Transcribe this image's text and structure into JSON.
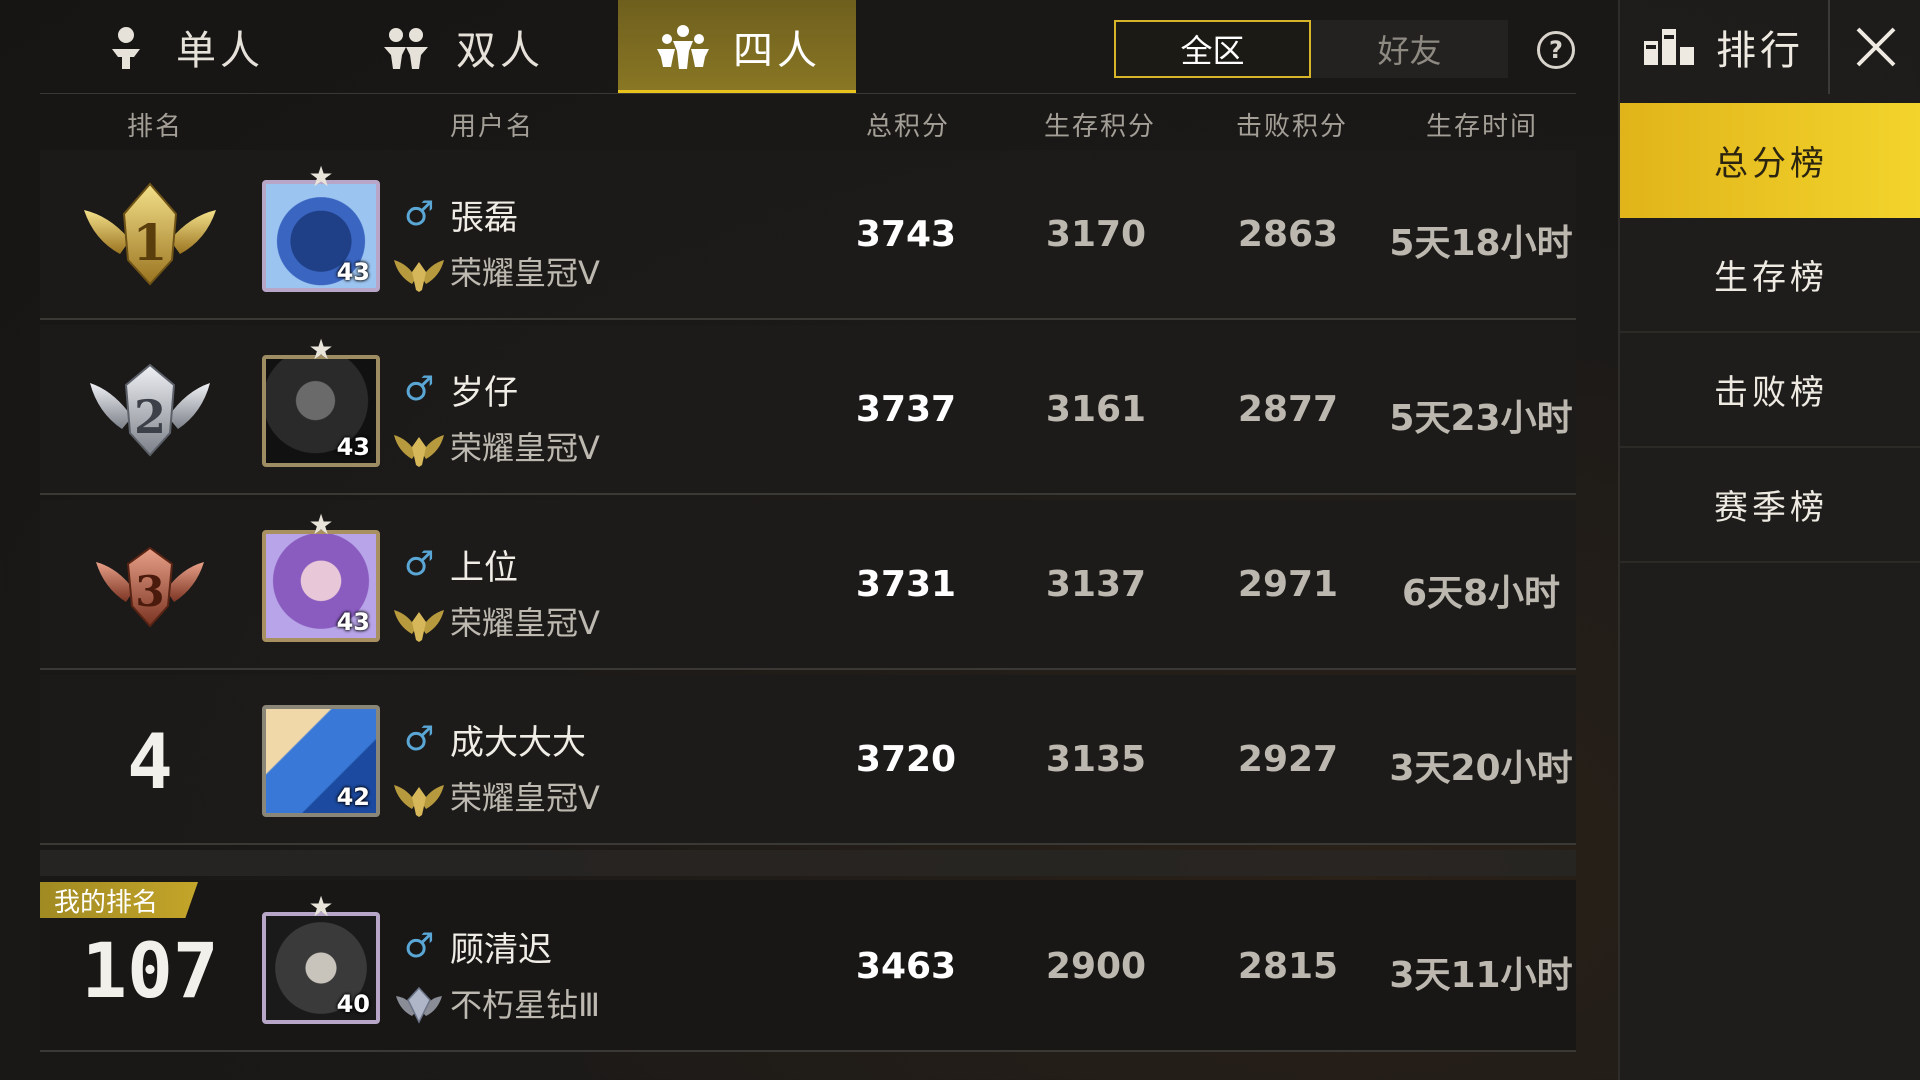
{
  "tabs": [
    {
      "label": "单人",
      "icon": "solo-person-icon",
      "active": false
    },
    {
      "label": "双人",
      "icon": "duo-persons-icon",
      "active": false
    },
    {
      "label": "四人",
      "icon": "squad-persons-icon",
      "active": true
    }
  ],
  "region": {
    "all_label": "全区",
    "friends_label": "好友",
    "selected": "全区"
  },
  "help_label": "?",
  "columns": {
    "rank": "排名",
    "username": "用户名",
    "total": "总积分",
    "survival": "生存积分",
    "kills": "击败积分",
    "time": "生存时间"
  },
  "rows": [
    {
      "rank": "1",
      "name": "張磊",
      "gender": "♂",
      "tier": "荣耀皇冠Ⅴ",
      "level": "43",
      "total": "3743",
      "survival": "3170",
      "kills": "2863",
      "time": "5天18小时"
    },
    {
      "rank": "2",
      "name": "岁仔",
      "gender": "♂",
      "tier": "荣耀皇冠Ⅴ",
      "level": "43",
      "total": "3737",
      "survival": "3161",
      "kills": "2877",
      "time": "5天23小时"
    },
    {
      "rank": "3",
      "name": "上位",
      "gender": "♂",
      "tier": "荣耀皇冠Ⅴ",
      "level": "43",
      "total": "3731",
      "survival": "3137",
      "kills": "2971",
      "time": "6天8小时"
    },
    {
      "rank": "4",
      "name": "成大大大",
      "gender": "♂",
      "tier": "荣耀皇冠Ⅴ",
      "level": "42",
      "total": "3720",
      "survival": "3135",
      "kills": "2927",
      "time": "3天20小时"
    }
  ],
  "me": {
    "badge": "我的排名",
    "rank": "107",
    "name": "顾清迟",
    "gender": "♂",
    "tier": "不朽星钻Ⅲ",
    "level": "40",
    "total": "3463",
    "survival": "2900",
    "kills": "2815",
    "time": "3天11小时"
  },
  "sidebar": {
    "title": "排行",
    "title_icon": "leaderboard-icon",
    "close_icon": "close-icon",
    "items": [
      {
        "label": "总分榜",
        "active": true
      },
      {
        "label": "生存榜",
        "active": false
      },
      {
        "label": "击败榜",
        "active": false
      },
      {
        "label": "赛季榜",
        "active": false
      }
    ]
  },
  "colors": {
    "accent": "#e8c21c",
    "gender": "#5aa7d6",
    "gold": "#c9a63a",
    "silver": "#b9bcc4",
    "bronze": "#b5613f"
  }
}
